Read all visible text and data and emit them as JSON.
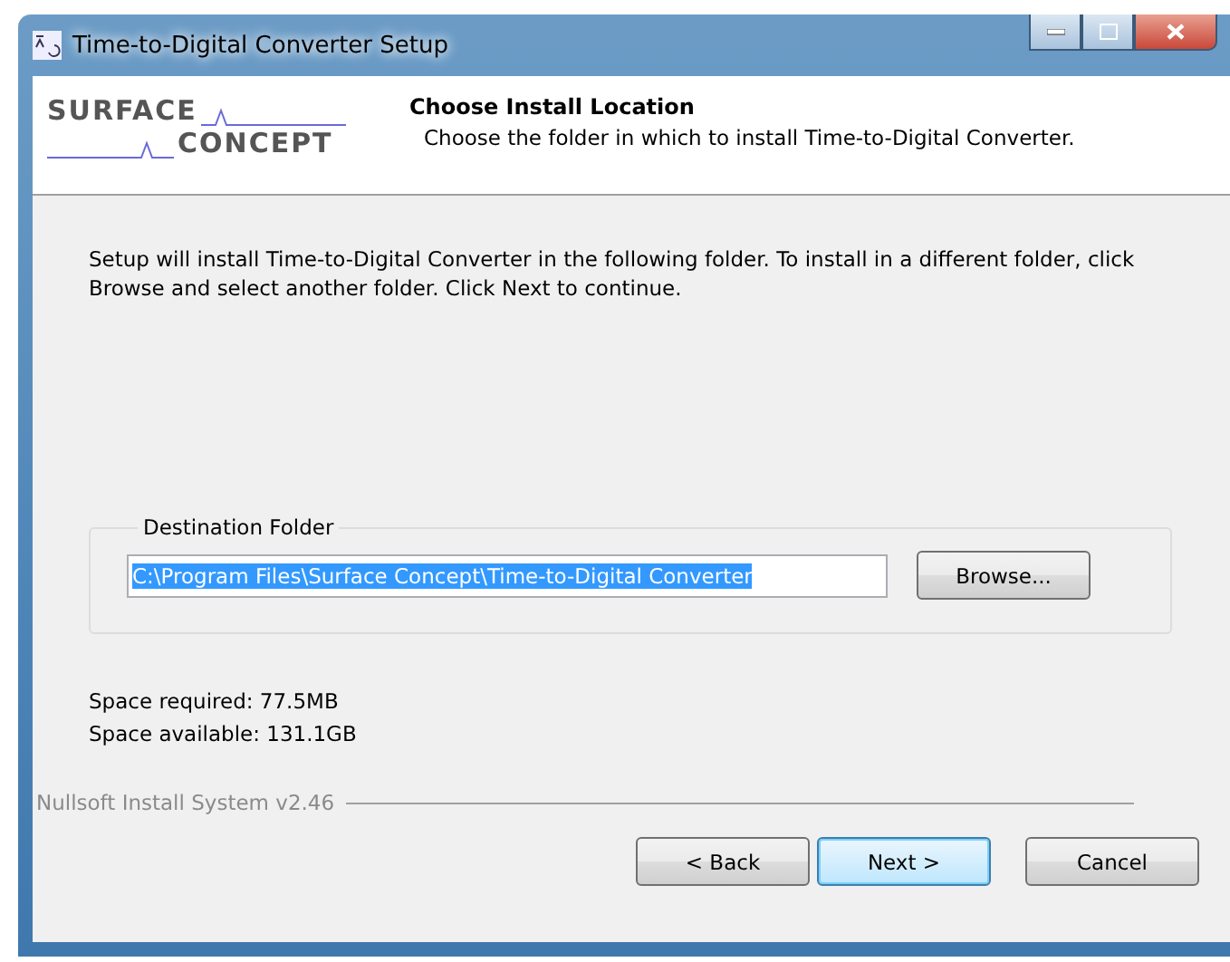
{
  "window": {
    "title": "Time-to-Digital Converter Setup"
  },
  "logo": {
    "line_1": "SURFACE",
    "line_2": "CONCEPT"
  },
  "header": {
    "title": "Choose Install Location",
    "subtitle": "Choose the folder in which to install Time-to-Digital Converter."
  },
  "description": "Setup will install Time-to-Digital Converter in the following folder. To install in a different folder, click Browse and select another folder. Click Next to continue.",
  "destination": {
    "label": "Destination Folder",
    "value": "C:\\Program Files\\Surface Concept\\Time-to-Digital Converter",
    "value_selected": true,
    "browse": "Browse..."
  },
  "space": [
    "Space required: 77.5MB",
    "Space available: 131.1GB"
  ],
  "branding": "Nullsoft Install System v2.46",
  "buttons": [
    {
      "label": "< Back",
      "default": false
    },
    {
      "label": "Next >",
      "default": true
    },
    {
      "label": "Cancel",
      "default": false
    }
  ]
}
